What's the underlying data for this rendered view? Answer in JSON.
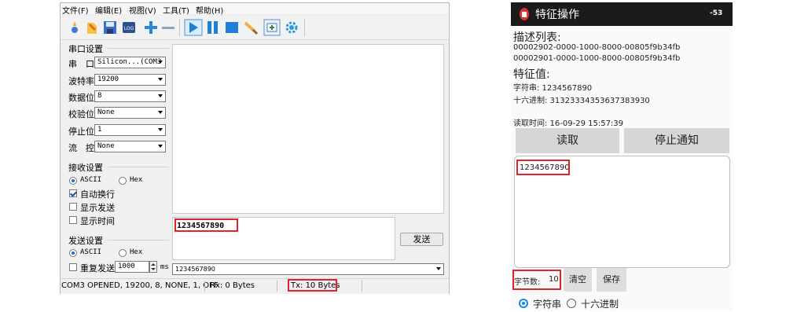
{
  "serial_tool": {
    "menu": [
      "文件(F)",
      "编辑(E)",
      "视图(V)",
      "工具(T)",
      "帮助(H)"
    ],
    "toolbar_icons": [
      "new-icon",
      "open-icon",
      "save-icon",
      "log-icon",
      "plus-icon",
      "minus-icon",
      "play-icon",
      "pause-icon",
      "stop-icon",
      "brush-icon",
      "add-window-icon",
      "gear-icon"
    ],
    "port_settings": {
      "title": "串口设置",
      "port_label": "串　口",
      "port_value": "Silicon...(COM3",
      "baud_label": "波特率",
      "baud_value": "19200",
      "data_bits_label": "数据位",
      "data_bits_value": "8",
      "parity_label": "校验位",
      "parity_value": "None",
      "stop_bits_label": "停止位",
      "stop_bits_value": "1",
      "flow_label": "流　控",
      "flow_value": "None"
    },
    "receive_settings": {
      "title": "接收设置",
      "ascii": "ASCII",
      "hex": "Hex",
      "auto_wrap": "自动换行",
      "show_send": "显示发送",
      "show_time": "显示时间"
    },
    "send_settings": {
      "title": "发送设置",
      "ascii": "ASCII",
      "hex": "Hex",
      "repeat": "重复发送",
      "interval": "1000",
      "unit": "ms"
    },
    "send_text": "1234567890",
    "send_button": "发送",
    "history_value": "1234567890",
    "status_port": "COM3 OPENED, 19200, 8, NONE, 1, OFF",
    "status_rx": "Rx: 0 Bytes",
    "status_tx": "Tx: 10 Bytes"
  },
  "phone": {
    "title": "特征操作",
    "signal": "-53",
    "desc_title": "描述列表:",
    "desc_items": [
      "00002902-0000-1000-8000-00805f9b34fb",
      "00002901-0000-1000-8000-00805f9b34fb"
    ],
    "value_title": "特征值:",
    "string_line": "字符串: 1234567890",
    "hex_line": "十六进制: 31323334353637383930",
    "read_time": "读取时间: 16-09-29 15:57:39",
    "read_button": "读取",
    "stop_notify_button": "停止通知",
    "received_text": "1234567890",
    "byte_count_label": "字节数:",
    "byte_count": "10",
    "clear_button": "清空",
    "save_button": "保存",
    "radio_string": "字符串",
    "radio_hex": "十六进制"
  }
}
